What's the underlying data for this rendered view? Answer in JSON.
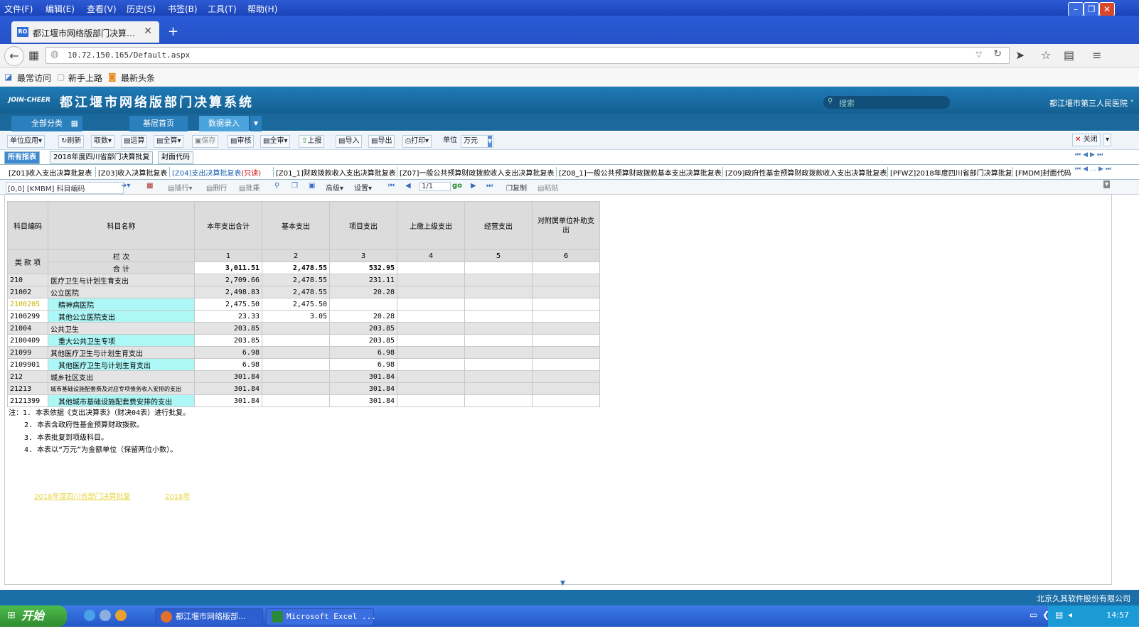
{
  "menubar": {
    "items": [
      "文件(F)",
      "编辑(E)",
      "查看(V)",
      "历史(S)",
      "书签(B)",
      "工具(T)",
      "帮助(H)"
    ]
  },
  "browser": {
    "tab_title": "都江堰市网络版部门决算…",
    "url": "10.72.150.165/Default.aspx",
    "bookmarks": [
      "最常访问",
      "新手上路",
      "最新头条"
    ]
  },
  "app": {
    "title": "都江堰市网络版部门决算系统",
    "logo": "JOIN-CHEER",
    "search_placeholder": "搜索",
    "unit_name": "都江堰市第三人民医院",
    "tabs": [
      "全部分类",
      "基层首页",
      "数据录入"
    ]
  },
  "toolbar": {
    "items": [
      "单位应用",
      "刷新",
      "取数",
      "运算",
      "全算",
      "保存",
      "审核",
      "全审",
      "上报",
      "导入",
      "导出",
      "打印",
      "单位"
    ],
    "unit_value": "万元",
    "close_label": "关闭"
  },
  "subtabs": [
    "所有报表",
    "2018年度四川省部门决算批复",
    "封面代码"
  ],
  "report_tabs": [
    "[Z01]收入支出决算批复表",
    "[Z03]收入决算批复表",
    "[Z04]支出决算批复表",
    "[Z01_1]财政拨款收入支出决算批复表",
    "[Z07]一般公共预算财政拨款收入支出决算批复表",
    "[Z08_1]一般公共预算财政拨款基本支出决算批复表",
    "[Z09]政府性基金预算财政拨款收入支出决算批复表",
    "[PFWZ]2018年度四川省部门决算批复",
    "[FMDM]封面代码"
  ],
  "report_active_readonly": "(只读)",
  "formula_bar": {
    "cell_ref": "[0,0] [KMBM] 科目编码",
    "row_buttons": [
      "插行",
      "删行",
      "批乘"
    ],
    "menus": [
      "高级",
      "设置"
    ],
    "page": "1/1",
    "go": "go",
    "copy": "复制",
    "paste": "粘贴"
  },
  "grid": {
    "headers": [
      "科目编码",
      "科目名称",
      "本年支出合计",
      "基本支出",
      "项目支出",
      "上缴上级支出",
      "经营支出",
      "对附属单位补助支出"
    ],
    "sub_code_header": "类 款 项",
    "column_label": "栏 次",
    "column_numbers": [
      "1",
      "2",
      "3",
      "4",
      "5",
      "6"
    ],
    "total_label": "合 计",
    "total": [
      "3,011.51",
      "2,478.55",
      "532.95",
      "",
      "",
      ""
    ],
    "rows": [
      {
        "code": "210",
        "name": "医疗卫生与计划生育支出",
        "v": [
          "2,709.66",
          "2,478.55",
          "231.11"
        ],
        "style": "grey"
      },
      {
        "code": "21002",
        "name": "公立医院",
        "v": [
          "2,498.83",
          "2,478.55",
          "20.28"
        ],
        "style": "grey"
      },
      {
        "code": "2100205",
        "name": "精神病医院",
        "v": [
          "2,475.50",
          "2,475.50",
          ""
        ],
        "style": "cyan-y"
      },
      {
        "code": "2100299",
        "name": "其他公立医院支出",
        "v": [
          "23.33",
          "3.05",
          "20.28"
        ],
        "style": "cyan"
      },
      {
        "code": "21004",
        "name": "公共卫生",
        "v": [
          "203.85",
          "",
          "203.85"
        ],
        "style": "grey"
      },
      {
        "code": "2100409",
        "name": "重大公共卫生专项",
        "v": [
          "203.85",
          "",
          "203.85"
        ],
        "style": "cyan"
      },
      {
        "code": "21099",
        "name": "其他医疗卫生与计划生育支出",
        "v": [
          "6.98",
          "",
          "6.98"
        ],
        "style": "grey"
      },
      {
        "code": "2109901",
        "name": "其他医疗卫生与计划生育支出",
        "v": [
          "6.98",
          "",
          "6.98"
        ],
        "style": "cyan"
      },
      {
        "code": "212",
        "name": "城乡社区支出",
        "v": [
          "301.84",
          "",
          "301.84"
        ],
        "style": "grey"
      },
      {
        "code": "21213",
        "name": "城市基础设施配套费及对应专项债务收入安排的支出",
        "v": [
          "301.84",
          "",
          "301.84"
        ],
        "style": "grey"
      },
      {
        "code": "2121399",
        "name": "其他城市基础设施配套费安排的支出",
        "v": [
          "301.84",
          "",
          "301.84"
        ],
        "style": "cyan"
      }
    ]
  },
  "notes": [
    "注：1. 本表依据《支出决算表》（财决04表）进行批复。",
    "2. 本表含政府性基金预算财政拨款。",
    "3. 本表批复到项级科目。",
    "4. 本表以“万元”为金额单位（保留两位小数）。"
  ],
  "footer_links": [
    "2018年度四川省部门决算批复",
    "2018年"
  ],
  "company": "北京久其软件股份有限公司",
  "taskbar": {
    "start": "开始",
    "tasks": [
      "都江堰市网络版部...",
      "Microsoft Excel ..."
    ],
    "clock": "14:57"
  }
}
